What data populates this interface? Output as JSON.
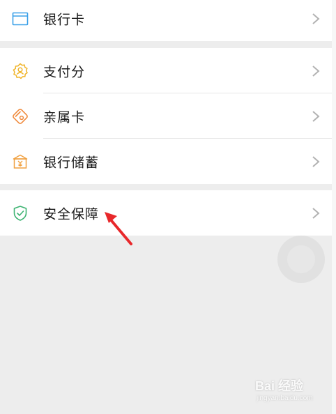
{
  "menu": {
    "group1": [
      {
        "label": "银行卡",
        "icon": "bank-card-icon",
        "color": "#3aa0e8"
      }
    ],
    "group2": [
      {
        "label": "支付分",
        "icon": "payment-score-icon",
        "color": "#f0b429"
      },
      {
        "label": "亲属卡",
        "icon": "family-card-icon",
        "color": "#f08a3c"
      },
      {
        "label": "银行储蓄",
        "icon": "bank-savings-icon",
        "color": "#f0a040"
      }
    ],
    "group3": [
      {
        "label": "安全保障",
        "icon": "shield-icon",
        "color": "#3cb371"
      }
    ]
  },
  "watermark": {
    "brand": "Bai 经验",
    "url": "jingyan.baidu.com"
  },
  "colors": {
    "background": "#ededed",
    "row_bg": "#ffffff",
    "chevron": "#b2b2b2",
    "arrow": "#e8282b"
  }
}
